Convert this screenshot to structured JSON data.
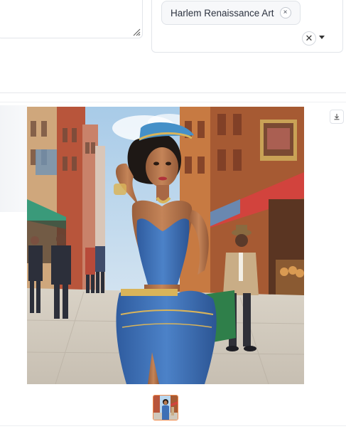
{
  "style_selector": {
    "selected_chip": "Harlem Renaissance Art",
    "chip_remove_glyph": "×",
    "clear_all_glyph": "✕"
  },
  "gallery": {
    "download_icon": "download-icon",
    "selected_thumbnail_index": 0
  },
  "colors": {
    "border": "#e2e5ea",
    "thumb_selected": "#f08a4b",
    "dress": "#3d6fb5",
    "sky": "#b9d6ee",
    "brick": "#a0552e"
  }
}
